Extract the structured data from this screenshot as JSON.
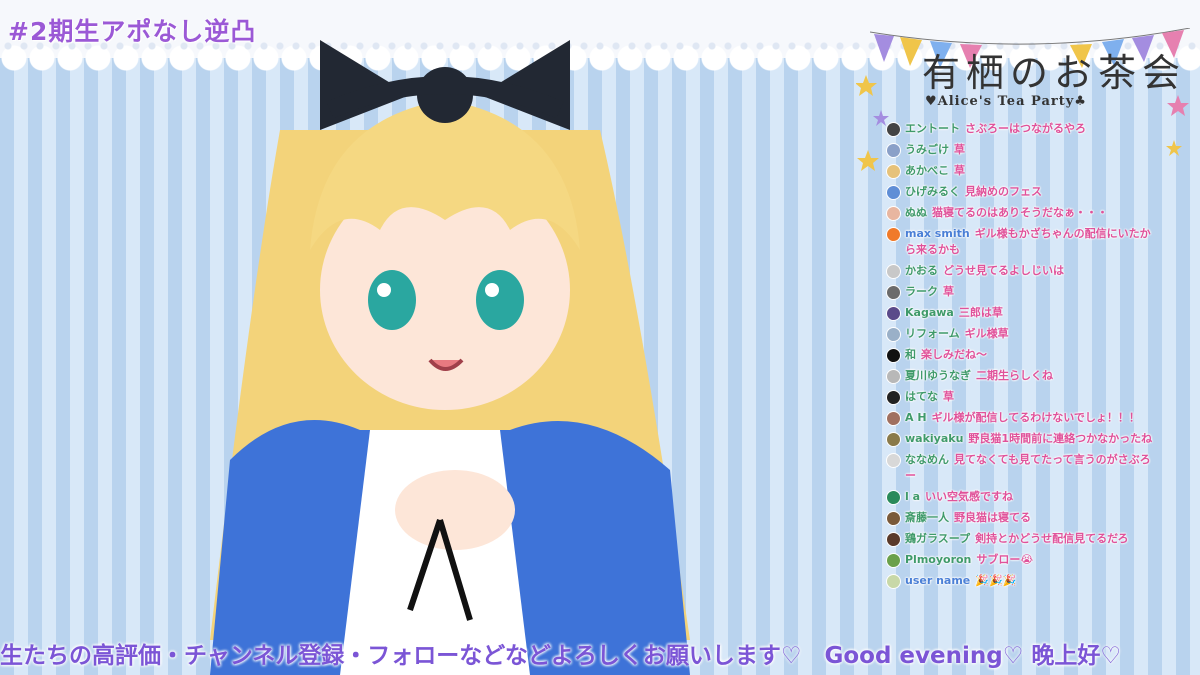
{
  "stream_title": "#2期生アポなし逆凸",
  "logo": {
    "title": "有栖のお茶会",
    "subtitle": "♥Alice's Tea Party♣"
  },
  "ticker": "生たちの高評価・チャンネル登録・フォローなどなどよろしくお願いします♡　Good evening♡ 晚上好♡",
  "colors": {
    "accent_purple": "#9b59d6",
    "chat_pink": "#e0529a",
    "chat_green": "#3f9a6a",
    "chat_blue": "#4a7fd6"
  },
  "chat": [
    {
      "author": "エントート",
      "text": "さぶろーはつながるやろ",
      "color": "#3f9a6a",
      "avatar": "#444"
    },
    {
      "author": "うみごけ",
      "text": "草",
      "color": "#3f9a6a",
      "avatar": "#8aa0c8"
    },
    {
      "author": "あかべこ",
      "text": "草",
      "color": "#3f9a6a",
      "avatar": "#e6c27a"
    },
    {
      "author": "ひげみるく",
      "text": "見納めのフェス",
      "color": "#3f9a6a",
      "avatar": "#5f8ed6"
    },
    {
      "author": "ぬぬ",
      "text": "猫寝てるのはありそうだなぁ・・・",
      "color": "#3f9a6a",
      "avatar": "#e8b6a0"
    },
    {
      "author": "max smith",
      "text": "ギル様もかざちゃんの配信にいたから来るかも",
      "color": "#4a7fd6",
      "avatar": "#f07a2a"
    },
    {
      "author": "かおる",
      "text": "どうせ見てるよしじいは",
      "color": "#3f9a6a",
      "avatar": "#c8c8c8"
    },
    {
      "author": "ラーク",
      "text": "草",
      "color": "#3f9a6a",
      "avatar": "#6b6b6b"
    },
    {
      "author": "Kagawa",
      "text": "三郎は草",
      "color": "#3f9a6a",
      "avatar": "#5a4a8a"
    },
    {
      "author": "リフォーム",
      "text": "ギル様草",
      "color": "#3f9a6a",
      "avatar": "#9ab0c8"
    },
    {
      "author": "和",
      "text": "楽しみだね～",
      "color": "#3f9a6a",
      "avatar": "#111"
    },
    {
      "author": "夏川ゆうなぎ",
      "text": "二期生らしくね",
      "color": "#3f9a6a",
      "avatar": "#b8b8b8"
    },
    {
      "author": "はてな",
      "text": "草",
      "color": "#3f9a6a",
      "avatar": "#222"
    },
    {
      "author": "A H",
      "text": "ギル様が配信してるわけないでしょ！！！",
      "color": "#3f9a6a",
      "avatar": "#a07060"
    },
    {
      "author": "wakiyaku",
      "text": "野良猫1時間前に連絡つかなかったね",
      "color": "#3f9a6a",
      "avatar": "#8a7a4a"
    },
    {
      "author": "ななめん",
      "text": "見てなくても見てたって言うのがさぶろー",
      "color": "#3f9a6a",
      "avatar": "#d8d8d8"
    },
    {
      "author": "l a",
      "text": "いい空気感ですね",
      "color": "#3f9a6a",
      "avatar": "#2a8a5a"
    },
    {
      "author": "斎藤一人",
      "text": "野良猫は寝てる",
      "color": "#3f9a6a",
      "avatar": "#7a5a3a"
    },
    {
      "author": "鶏ガラスープ",
      "text": "剣持とかどうせ配信見てるだろ",
      "color": "#3f9a6a",
      "avatar": "#5a3a2a"
    },
    {
      "author": "Plmoyoron",
      "text": "サブロー😭",
      "color": "#3f9a6a",
      "avatar": "#6aa04a"
    },
    {
      "author": "user name",
      "text": "🎉🎉🎉",
      "color": "#4a7fd6",
      "avatar": "#c8d8a8"
    }
  ]
}
